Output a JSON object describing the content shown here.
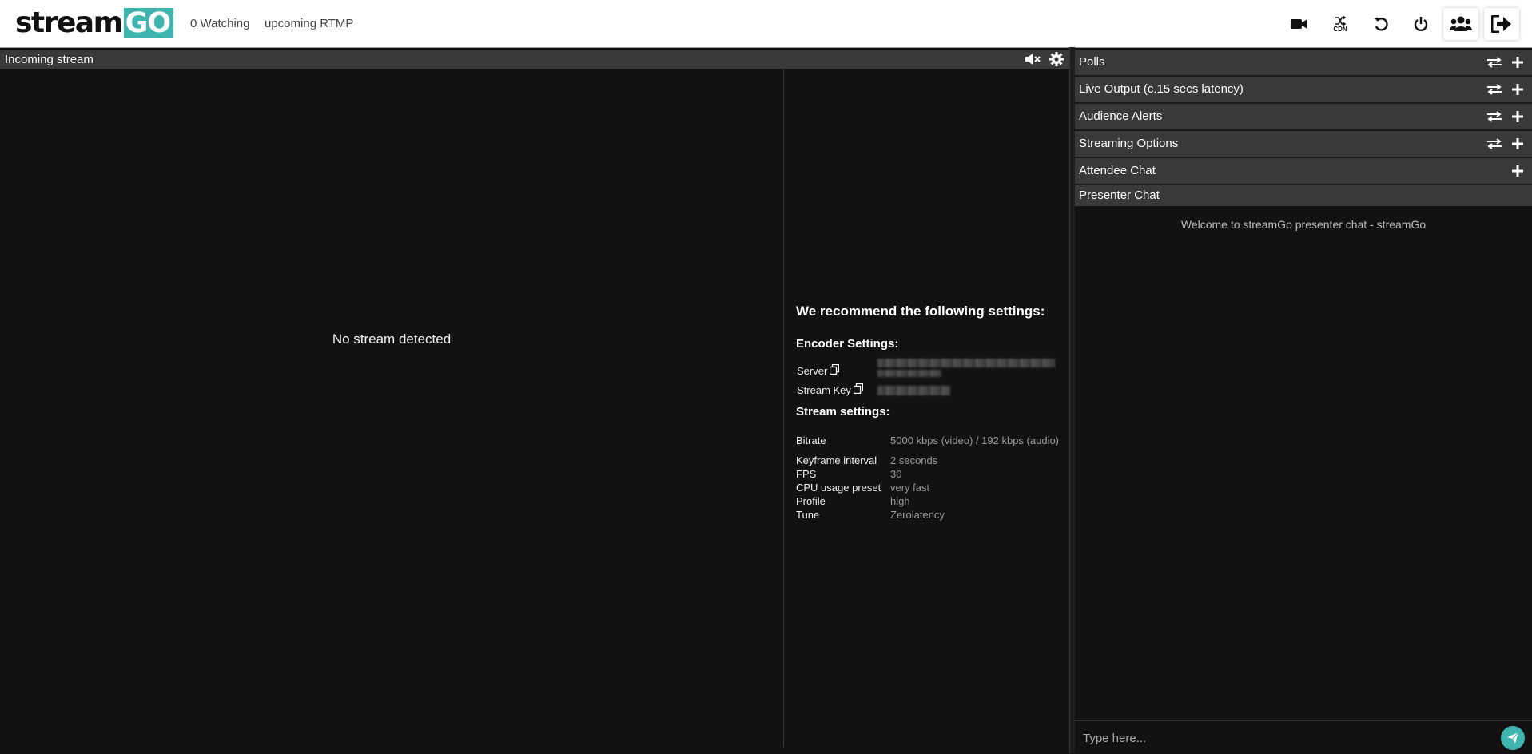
{
  "header": {
    "logo_stream": "stream",
    "logo_go": "GO",
    "watching": "0 Watching",
    "upcoming": "upcoming RTMP",
    "cdn_label": "CDN"
  },
  "incoming": {
    "title": "Incoming stream",
    "no_stream": "No stream detected"
  },
  "settings": {
    "recommend_title": "We recommend the following settings:",
    "encoder_title": "Encoder Settings:",
    "server_label": "Server",
    "stream_key_label": "Stream Key",
    "stream_settings_title": "Stream settings:",
    "rows": [
      {
        "key": "Bitrate",
        "value": "5000 kbps (video) / 192 kbps (audio)"
      },
      {
        "key": "Keyframe interval",
        "value": "2 seconds"
      },
      {
        "key": "FPS",
        "value": "30"
      },
      {
        "key": "CPU usage preset",
        "value": "very fast"
      },
      {
        "key": "Profile",
        "value": "high"
      },
      {
        "key": "Tune",
        "value": "Zerolatency"
      }
    ]
  },
  "panels": [
    {
      "title": "Polls"
    },
    {
      "title": "Live Output (c.15 secs latency)"
    },
    {
      "title": "Audience Alerts"
    },
    {
      "title": "Streaming Options"
    },
    {
      "title": "Attendee Chat"
    },
    {
      "title": "Presenter Chat"
    }
  ],
  "chat": {
    "welcome": "Welcome to streamGo presenter chat - streamGo",
    "placeholder": "Type here..."
  },
  "colors": {
    "accent": "#3fb5b0",
    "panel_bg": "#393939",
    "page_bg": "#121212"
  }
}
